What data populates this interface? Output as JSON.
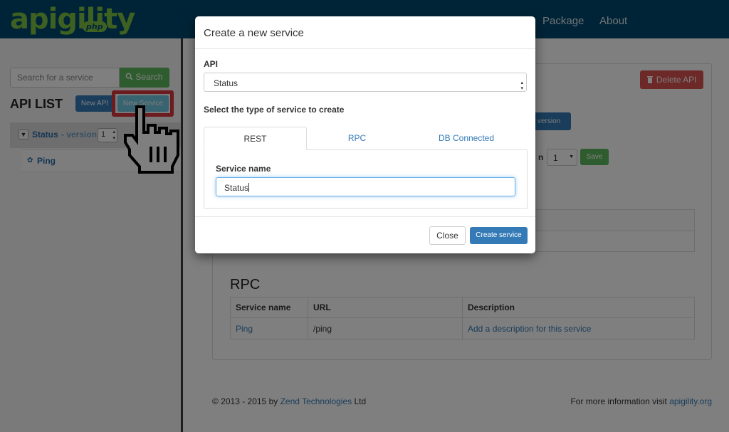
{
  "header": {
    "logo_text": "apigility",
    "logo_badge": "php",
    "nav": [
      "Package",
      "About"
    ]
  },
  "sidebar": {
    "search_placeholder": "Search for a service",
    "search_button": "Search",
    "api_list_title": "API LIST",
    "new_api_button": "New API",
    "new_service_button": "New Service",
    "api": {
      "name": "Status",
      "version_label": "- version",
      "version": "1"
    },
    "services": [
      {
        "name": "Ping"
      }
    ]
  },
  "main": {
    "delete_api_button": "Delete API",
    "new_version_button_fragment": "w version",
    "version_label_fragment": "n",
    "version_select": "1",
    "save_button": "Save",
    "rpc_title": "RPC",
    "rpc_table": {
      "headers": [
        "Service name",
        "URL",
        "Description"
      ],
      "rows": [
        [
          "Ping",
          "/ping",
          "Add a description for this service"
        ]
      ]
    }
  },
  "footer": {
    "copyright_prefix": "© 2013 - 2015 by",
    "company": "Zend Technologies",
    "copyright_suffix": "Ltd",
    "info_prefix": "For more information visit",
    "info_link": "apigility.org"
  },
  "modal": {
    "title": "Create a new service",
    "api_label": "API",
    "api_selected": "Status",
    "type_label": "Select the type of service to create",
    "tabs": [
      "REST",
      "RPC",
      "DB Connected"
    ],
    "active_tab": "REST",
    "service_name_label": "Service name",
    "service_name_value": "Status",
    "close_button": "Close",
    "create_button": "Create service"
  },
  "colors": {
    "navbar": "#01496e",
    "logo": "#7cc344",
    "primary": "#337ab7",
    "success": "#5cb85c",
    "danger": "#d9534f",
    "highlight": "#d9363e"
  },
  "icons": [
    "search-icon",
    "chevron-down-icon",
    "service-icon",
    "trash-icon",
    "pointer-cursor-icon",
    "select-caret-icon"
  ]
}
